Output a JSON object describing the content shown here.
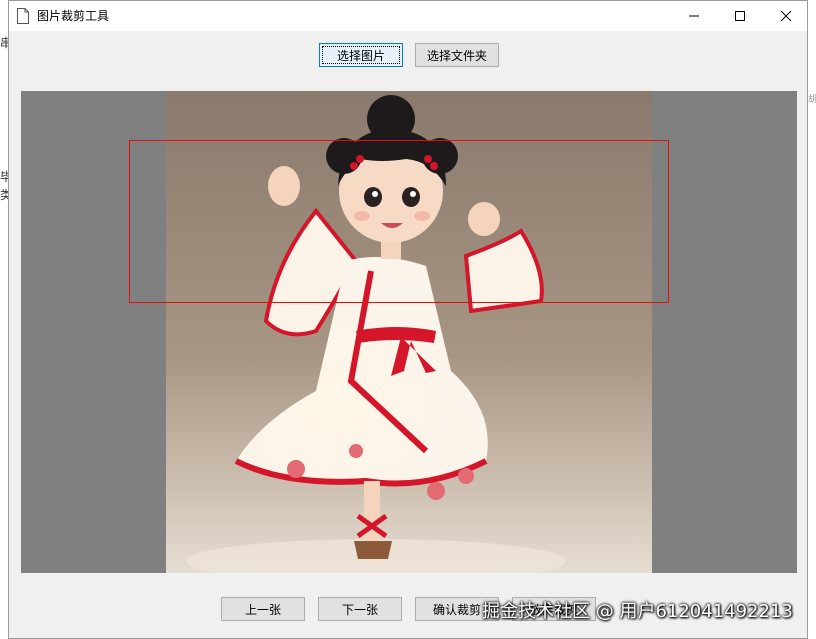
{
  "window": {
    "title": "图片裁剪工具"
  },
  "toolbar": {
    "select_image_label": "选择图片",
    "select_folder_label": "选择文件夹"
  },
  "navigation": {
    "prev_label": "上一张",
    "next_label": "下一张",
    "confirm_label": "确认裁剪",
    "cancel_label": "放弃裁剪"
  },
  "overlay": {
    "watermark": "掘金技术社区 @ 用户612041492213"
  },
  "background_fragments": {
    "a": "串",
    "b": "毕",
    "c": "类",
    "d": "胡"
  },
  "colors": {
    "canvas_bg": "#808080",
    "crop_border": "#e01010",
    "accent_red": "#d4152a"
  },
  "icons": {
    "title_icon": "document-icon",
    "minimize": "minimize-icon",
    "maximize": "maximize-icon",
    "close": "close-icon"
  }
}
